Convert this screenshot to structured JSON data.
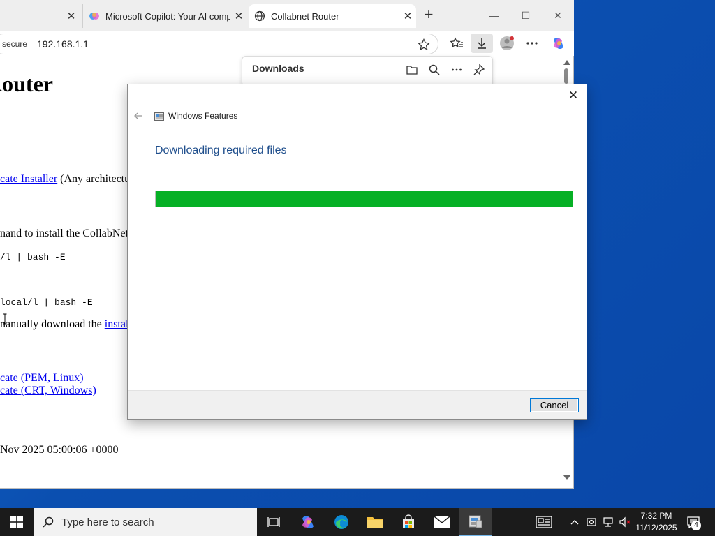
{
  "browser": {
    "tabs": [
      {
        "label": "",
        "icon": "tab-partial-icon"
      },
      {
        "label": "Microsoft Copilot: Your AI compa",
        "icon": "copilot-icon"
      },
      {
        "label": "Collabnet Router",
        "icon": "globe-icon",
        "active": true
      }
    ],
    "window_controls": [
      "minimize",
      "maximize",
      "close"
    ],
    "address_bar": {
      "security": "secure",
      "url": "192.168.1.1"
    }
  },
  "downloads": {
    "title": "Downloads"
  },
  "page": {
    "heading": "Router",
    "lines": {
      "installer_link": "cate Installer",
      "installer_rest": " (Any architectu",
      "cmd_intro": "nand to install the CollabNet",
      "cmd1": "/l | bash -E",
      "cmd2": "local/l | bash -E",
      "manual_prefix": "nanually download the ",
      "manual_link": "instal",
      "pem_link": "cate (PEM, Linux)",
      "crt_link": "cate (CRT, Windows)",
      "date": "Nov 2025 05:00:06 +0000"
    }
  },
  "dialog": {
    "app_title": "Windows Features",
    "heading": "Downloading required files",
    "progress": 1.0,
    "progress_color": "#06b025",
    "cancel_label": "Cancel"
  },
  "taskbar": {
    "search_placeholder": "Type here to search",
    "time": "7:32 PM",
    "date": "11/12/2025",
    "notification_count": "4"
  }
}
